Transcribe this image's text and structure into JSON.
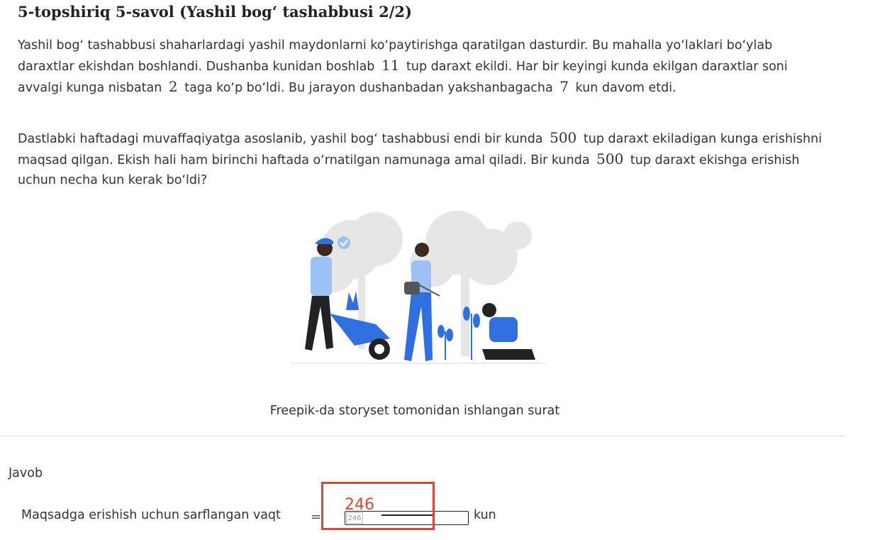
{
  "question": {
    "title": "5-topshiriq 5-savol (Yashil bog‘ tashabbusi 2/2)",
    "para1": {
      "t1": "Yashil bog‘ tashabbusi shaharlardagi yashil maydonlarni ko‘paytirishga qaratilgan dasturdir. Bu mahalla yo‘laklari bo‘ylab daraxtlar ekishdan boshlandi. Dushanba kunidan boshlab",
      "n1": "11",
      "t2": "tup daraxt ekildi. Har bir keyingi kunda ekilgan daraxtlar soni avvalgi kunga nisbatan",
      "n2": "2",
      "t3": "taga ko‘p bo‘ldi. Bu jarayon dushanbadan yakshanbagacha",
      "n3": "7",
      "t4": "kun davom etdi."
    },
    "para2": {
      "t1": "Dastlabki haftadagi muvaffaqiyatga asoslanib, yashil bog‘ tashabbusi endi bir kunda",
      "n1": "500",
      "t2": "tup daraxt ekiladigan kunga erishishni maqsad qilgan. Ekish hali ham birinchi haftada o‘rnatilgan namunaga amal qiladi. Bir kunda",
      "n2": "500",
      "t3": "tup daraxt ekishga erishish uchun necha kun kerak bo‘ldi?"
    },
    "caption": "Freepik-da storyset tomonidan ishlangan surat"
  },
  "answer": {
    "heading": "Javob",
    "label": "Maqsadga erishish uchun sarflangan vaqt",
    "equals": "=",
    "input_value": "246",
    "unit": "kun",
    "overlay_value": "246"
  },
  "colors": {
    "accent_blue": "#2f6fe0",
    "annotation_red": "#d9473a"
  }
}
